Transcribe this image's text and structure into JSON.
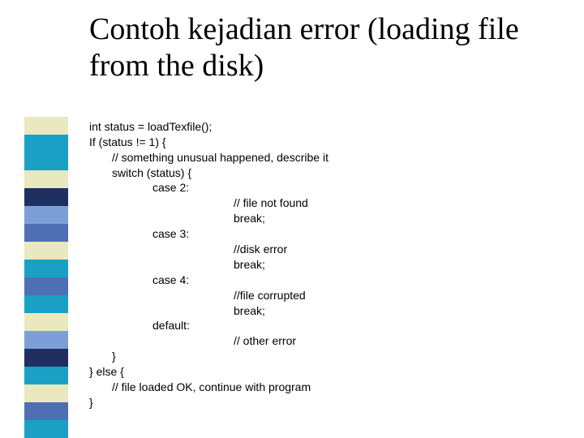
{
  "title": "Contoh kejadian error (loading file from the disk)",
  "sidebar_colors": [
    "#eae8bf",
    "#1aa0c5",
    "#1aa0c5",
    "#eae8bf",
    "#1e2f60",
    "#7b9fd6",
    "#4f6fb5",
    "#eae8bf",
    "#1aa0c5",
    "#4f6fb5",
    "#1aa0c5",
    "#eae8bf",
    "#7b9fd6",
    "#1e2f60",
    "#1aa0c5",
    "#eae8bf",
    "#4f6fb5",
    "#1aa0c5"
  ],
  "code": {
    "l01": "int status = loadTexfile();",
    "l02": "If (status != 1) {",
    "l03": "// something unusual happened, describe it",
    "l04": "switch (status) {",
    "l05": "case 2:",
    "l06": "// file not found",
    "l07": "break;",
    "l08": "case 3:",
    "l09": "//disk error",
    "l10": "break;",
    "l11": "case 4:",
    "l12": "//file corrupted",
    "l13": "break;",
    "l14": "default:",
    "l15": "// other error",
    "l16": "}",
    "l17": "} else {",
    "l18": "// file loaded OK, continue with program",
    "l19": "}"
  }
}
